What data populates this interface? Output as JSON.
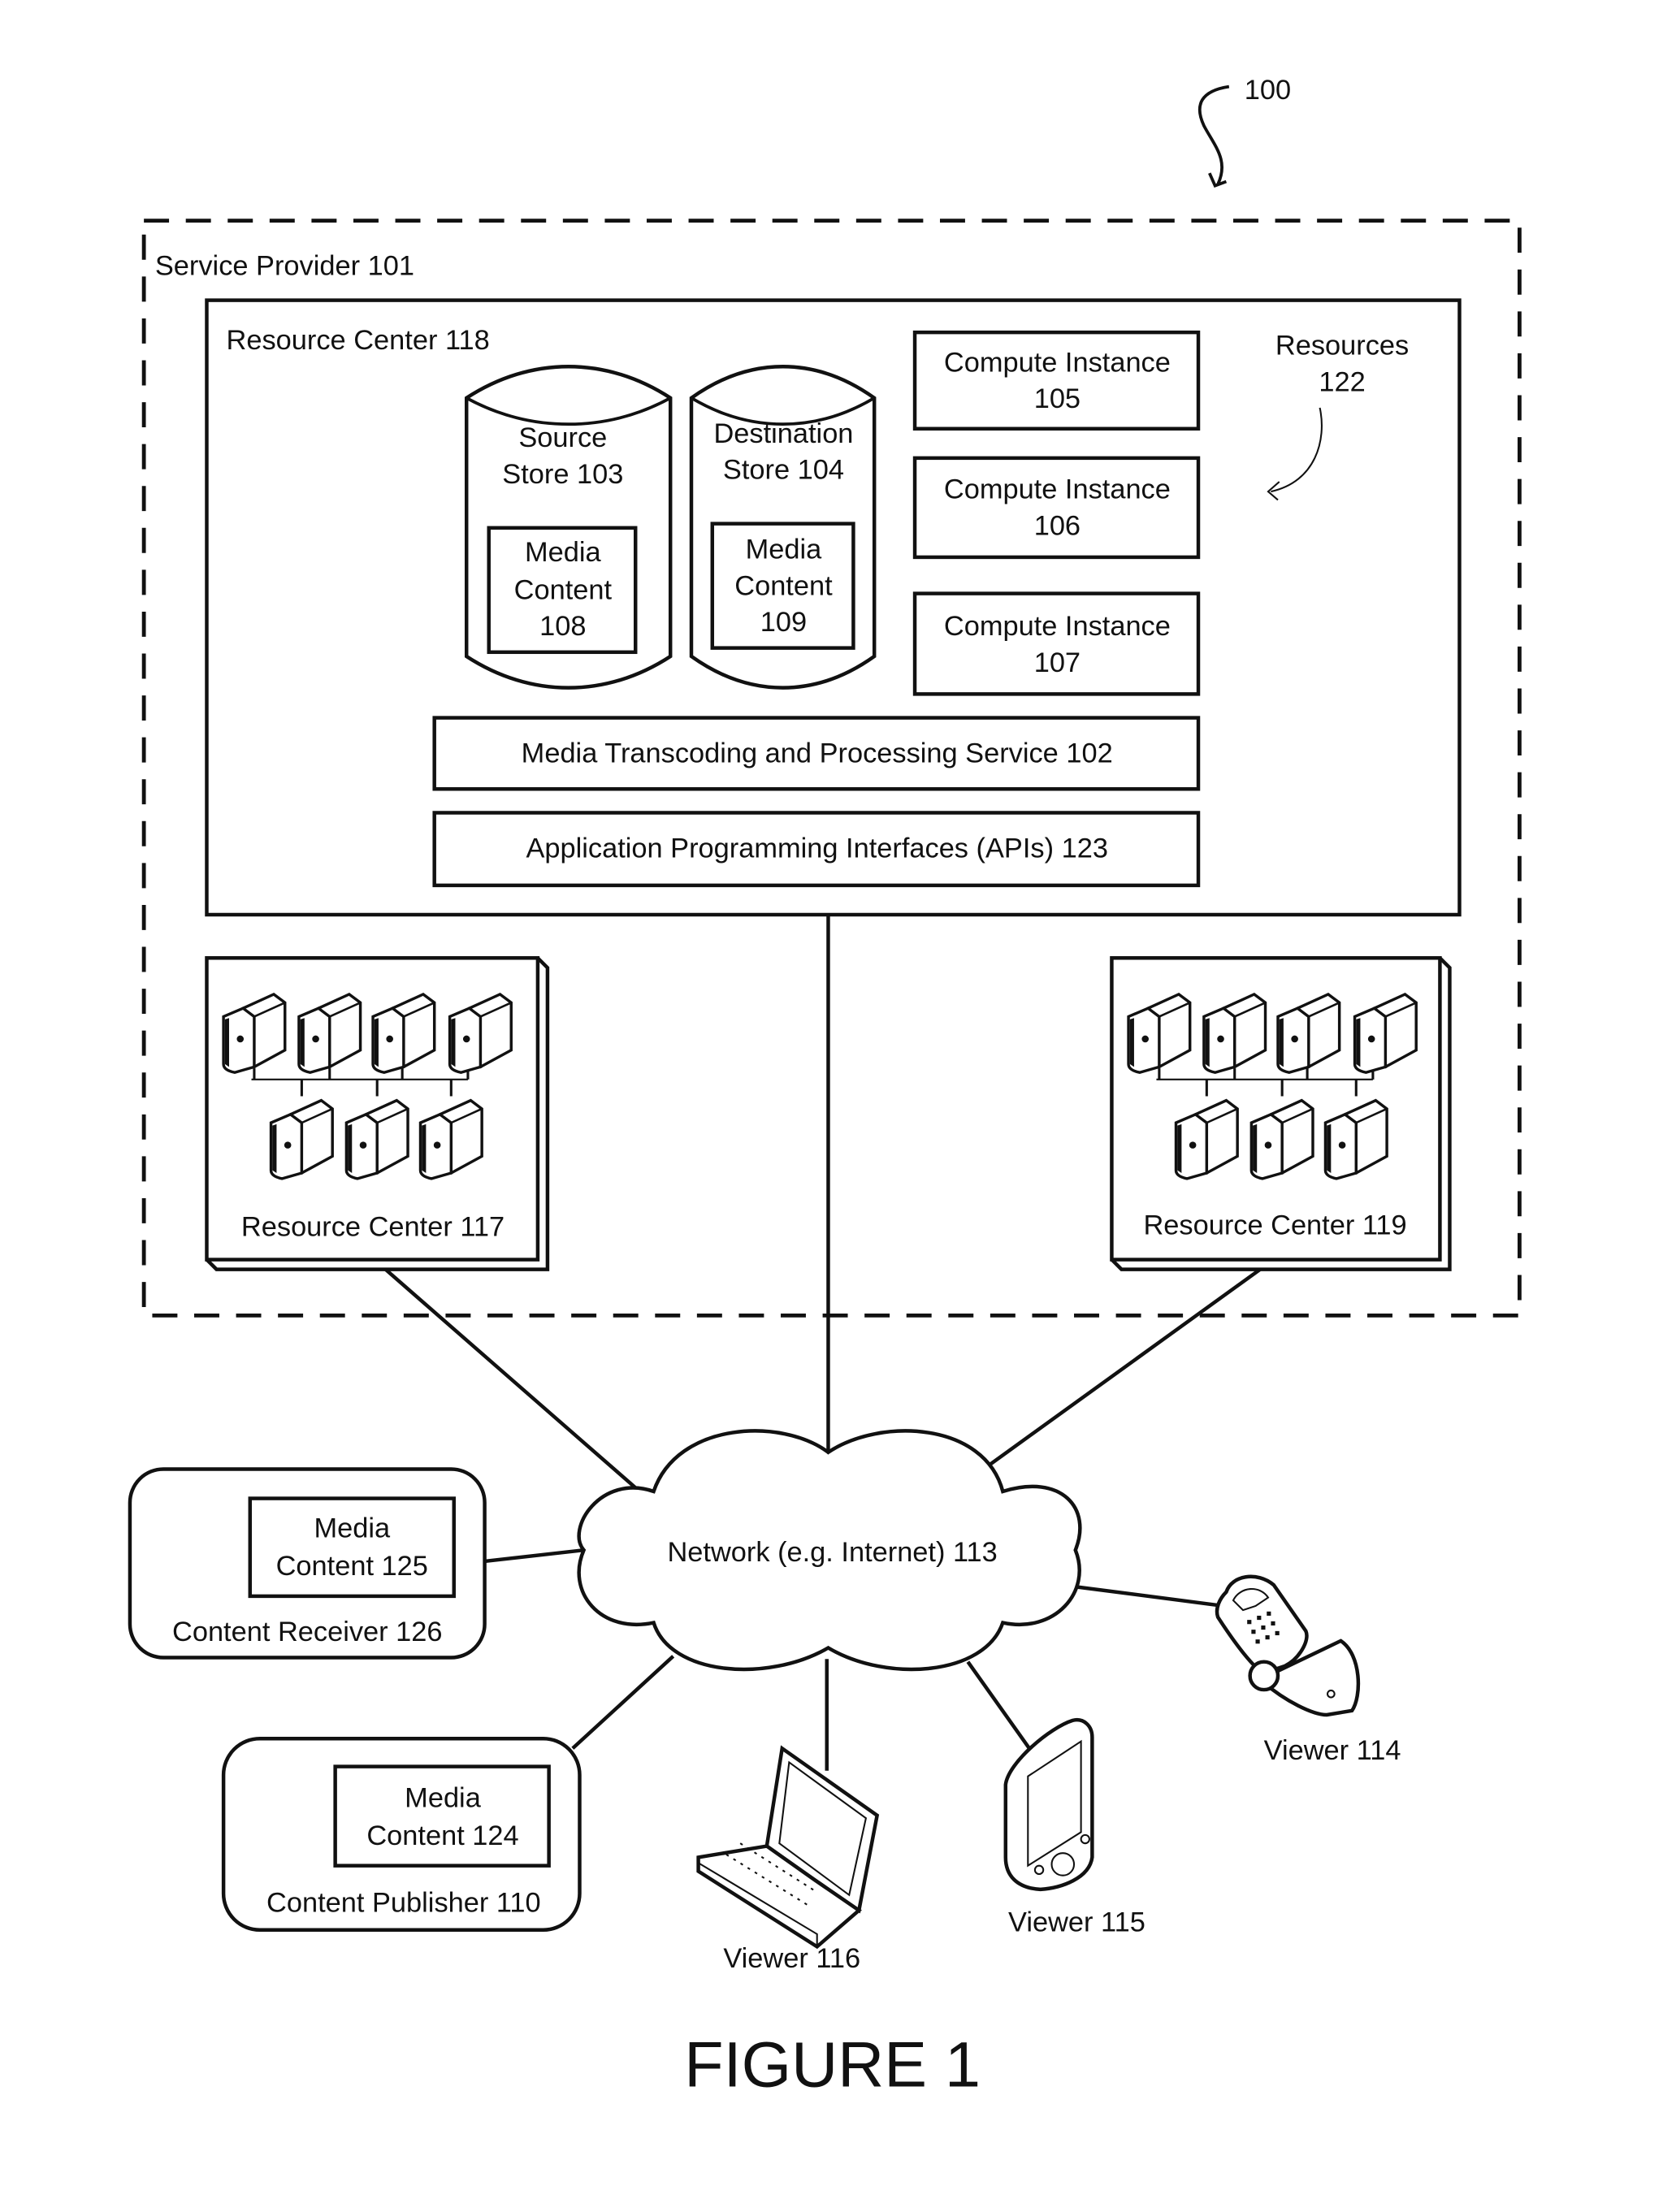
{
  "figure": {
    "reference_number": "100",
    "caption": "FIGURE 1"
  },
  "service_provider": {
    "label": "Service Provider 101"
  },
  "resource_center_118": {
    "label": "Resource Center 118",
    "source_store": {
      "line1": "Source",
      "line2": "Store 103",
      "media": [
        "Media",
        "Content",
        "108"
      ]
    },
    "destination_store": {
      "line1": "Destination",
      "line2": "Store 104",
      "media": [
        "Media",
        "Content",
        "109"
      ]
    },
    "compute_instances": [
      {
        "line1": "Compute Instance",
        "line2": "105"
      },
      {
        "line1": "Compute Instance",
        "line2": "106"
      },
      {
        "line1": "Compute Instance",
        "line2": "107"
      }
    ],
    "resources": {
      "line1": "Resources",
      "line2": "122"
    },
    "service": "Media Transcoding and Processing Service 102",
    "apis": "Application Programming Interfaces (APIs) 123"
  },
  "resource_center_117": {
    "label": "Resource Center 117",
    "server_icon": "server-rack-icon",
    "server_count": 7
  },
  "resource_center_119": {
    "label": "Resource Center 119",
    "server_icon": "server-rack-icon",
    "server_count": 7
  },
  "network": {
    "label": "Network (e.g. Internet) 113",
    "icon": "cloud-icon"
  },
  "content_receiver": {
    "label": "Content Receiver 126",
    "media": [
      "Media",
      "Content 125"
    ]
  },
  "content_publisher": {
    "label": "Content Publisher 110",
    "media": [
      "Media",
      "Content 124"
    ]
  },
  "viewers": [
    {
      "label": "Viewer 114",
      "icon": "flip-phone-icon"
    },
    {
      "label": "Viewer 115",
      "icon": "pda-icon"
    },
    {
      "label": "Viewer 116",
      "icon": "laptop-icon"
    }
  ]
}
